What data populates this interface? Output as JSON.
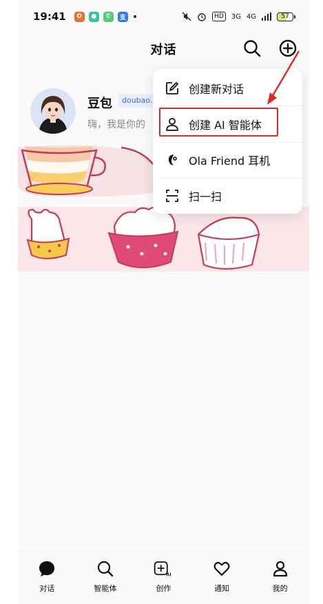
{
  "status_bar": {
    "time": "19:41",
    "apps": [
      {
        "icon": "orange-app-icon",
        "color": "#e8732b",
        "glyph": "O"
      },
      {
        "icon": "teal-app-icon",
        "color": "#36c2a5",
        "glyph": "●"
      },
      {
        "icon": "phone-app-icon",
        "color": "#58c87a",
        "glyph": "✆"
      },
      {
        "icon": "alipay-app-icon",
        "color": "#2f7bf0",
        "glyph": "支"
      }
    ],
    "signal_1": "3G",
    "signal_2": "4G",
    "battery": "57"
  },
  "header": {
    "title": "对话",
    "search_icon": "search-icon",
    "add_icon": "plus-circle-icon"
  },
  "conversation": {
    "name": "豆包",
    "badge": "doubao.c",
    "preview": "嗨，我是你的"
  },
  "menu": {
    "items": [
      {
        "label": "创建新对话",
        "icon": "edit-icon"
      },
      {
        "label": "创建 AI 智能体",
        "icon": "person-icon"
      },
      {
        "label": "Ola Friend 耳机",
        "icon": "earbud-icon"
      },
      {
        "label": "扫一扫",
        "icon": "scan-icon"
      }
    ]
  },
  "bottom_nav": {
    "items": [
      {
        "label": "对话",
        "icon": "chat-bubble-icon"
      },
      {
        "label": "智能体",
        "icon": "search-icon"
      },
      {
        "label": "创作",
        "icon": "create-ai-icon"
      },
      {
        "label": "通知",
        "icon": "heart-icon"
      },
      {
        "label": "我的",
        "icon": "profile-icon"
      }
    ]
  },
  "colors": {
    "highlight": "#e02828",
    "badge_text": "#3b6bd4",
    "battery_fill": "#cfe97a"
  }
}
